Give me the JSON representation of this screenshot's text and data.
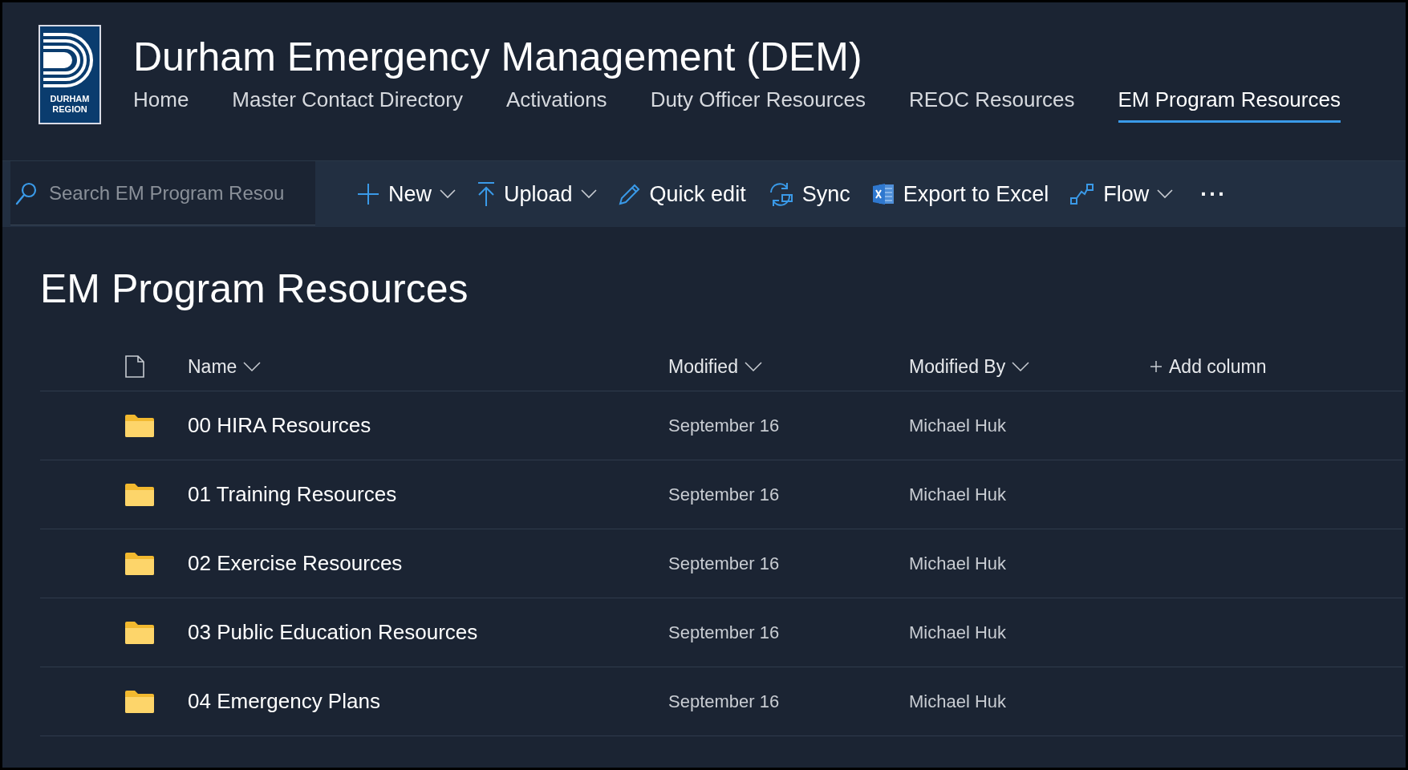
{
  "logo": {
    "lines": [
      "DURHAM",
      "REGION"
    ]
  },
  "site_title": "Durham Emergency Management (DEM)",
  "nav": [
    {
      "label": "Home",
      "selected": false
    },
    {
      "label": "Master Contact Directory",
      "selected": false
    },
    {
      "label": "Activations",
      "selected": false
    },
    {
      "label": "Duty Officer Resources",
      "selected": false
    },
    {
      "label": "REOC Resources",
      "selected": false
    },
    {
      "label": "EM Program Resources",
      "selected": true
    }
  ],
  "search": {
    "placeholder": "Search EM Program Resou"
  },
  "toolbar": [
    {
      "kind": "new",
      "label": "New",
      "caret": true
    },
    {
      "kind": "upload",
      "label": "Upload",
      "caret": true
    },
    {
      "kind": "edit",
      "label": "Quick edit",
      "caret": false
    },
    {
      "kind": "sync",
      "label": "Sync",
      "caret": false
    },
    {
      "kind": "excel",
      "label": "Export to Excel",
      "caret": false
    },
    {
      "kind": "flow",
      "label": "Flow",
      "caret": true
    },
    {
      "kind": "more",
      "label": "···",
      "caret": false
    }
  ],
  "page_title": "EM Program Resources",
  "table": {
    "columns": [
      {
        "label": "Name",
        "sortable": true
      },
      {
        "label": "Modified",
        "sortable": true
      },
      {
        "label": "Modified By",
        "sortable": true
      }
    ],
    "add_column": "Add column",
    "rows": [
      {
        "name": "00 HIRA Resources",
        "modified": "September 16",
        "modified_by": "Michael Huk"
      },
      {
        "name": "01 Training Resources",
        "modified": "September 16",
        "modified_by": "Michael Huk"
      },
      {
        "name": "02 Exercise Resources",
        "modified": "September 16",
        "modified_by": "Michael Huk"
      },
      {
        "name": "03 Public Education Resources",
        "modified": "September 16",
        "modified_by": "Michael Huk"
      },
      {
        "name": "04 Emergency Plans",
        "modified": "September 16",
        "modified_by": "Michael Huk"
      }
    ]
  }
}
